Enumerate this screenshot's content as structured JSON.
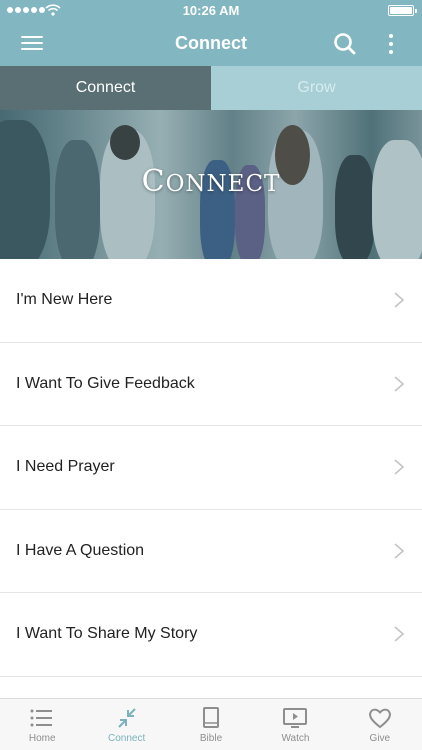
{
  "status_bar": {
    "time": "10:26 AM"
  },
  "nav_bar": {
    "title": "Connect",
    "icons": [
      "menu-icon",
      "search-icon",
      "more-vertical-icon"
    ]
  },
  "tabs": [
    {
      "label": "Connect",
      "active": true
    },
    {
      "label": "Grow",
      "active": false
    }
  ],
  "hero": {
    "title_first": "C",
    "title_rest": "ONNECT"
  },
  "list_items": [
    {
      "label": "I'm New Here"
    },
    {
      "label": "I Want To Give Feedback"
    },
    {
      "label": "I Need Prayer"
    },
    {
      "label": "I Have A Question"
    },
    {
      "label": "I Want To Share My Story"
    }
  ],
  "tab_bar": [
    {
      "label": "Home",
      "icon": "list-icon",
      "active": false
    },
    {
      "label": "Connect",
      "icon": "connect-arrows-icon",
      "active": true
    },
    {
      "label": "Bible",
      "icon": "book-icon",
      "active": false
    },
    {
      "label": "Watch",
      "icon": "video-icon",
      "active": false
    },
    {
      "label": "Give",
      "icon": "heart-icon",
      "active": false
    }
  ],
  "colors": {
    "header": "#82b6c0",
    "tab_active": "#5a6f73",
    "tab_inactive": "#a7cfd5",
    "tabbar_active": "#7ab3bc"
  }
}
